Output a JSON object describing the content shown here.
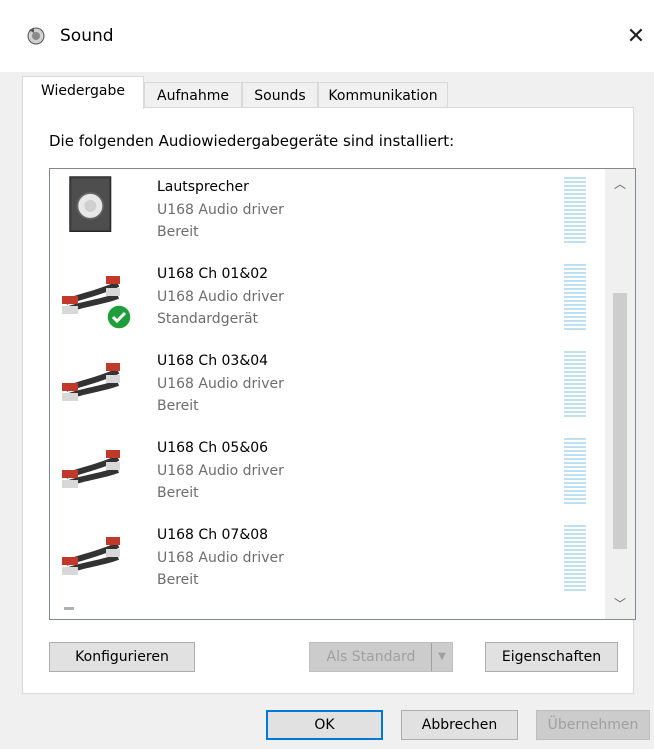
{
  "window": {
    "title": "Sound",
    "close_glyph": "✕"
  },
  "tabs": [
    {
      "label": "Wiedergabe",
      "active": true
    },
    {
      "label": "Aufnahme",
      "active": false
    },
    {
      "label": "Sounds",
      "active": false
    },
    {
      "label": "Kommunikation",
      "active": false
    }
  ],
  "panel": {
    "intro": "Die folgenden Audiowiedergabegeräte sind installiert:"
  },
  "devices": [
    {
      "name": "Lautsprecher",
      "driver": "U168 Audio driver",
      "status": "Bereit",
      "icon": "speaker-icon",
      "default": false
    },
    {
      "name": "U168 Ch 01&02",
      "driver": "U168 Audio driver",
      "status": "Standardgerät",
      "icon": "rca-cable-icon",
      "default": true
    },
    {
      "name": "U168 Ch 03&04",
      "driver": "U168 Audio driver",
      "status": "Bereit",
      "icon": "rca-cable-icon",
      "default": false
    },
    {
      "name": "U168 Ch 05&06",
      "driver": "U168 Audio driver",
      "status": "Bereit",
      "icon": "rca-cable-icon",
      "default": false
    },
    {
      "name": "U168 Ch 07&08",
      "driver": "U168 Audio driver",
      "status": "Bereit",
      "icon": "rca-cable-icon",
      "default": false
    }
  ],
  "scroll": {
    "up_glyph": "︿",
    "down_glyph": "﹀"
  },
  "panel_buttons": {
    "configure": "Konfigurieren",
    "set_default": "Als Standard",
    "set_default_arrow": "▼",
    "properties": "Eigenschaften"
  },
  "dialog_buttons": {
    "ok": "OK",
    "cancel": "Abbrechen",
    "apply": "Übernehmen"
  },
  "colors": {
    "default_check": "#1e9e3a",
    "meter": "#bfe0f0",
    "focus_border": "#0078d7"
  }
}
